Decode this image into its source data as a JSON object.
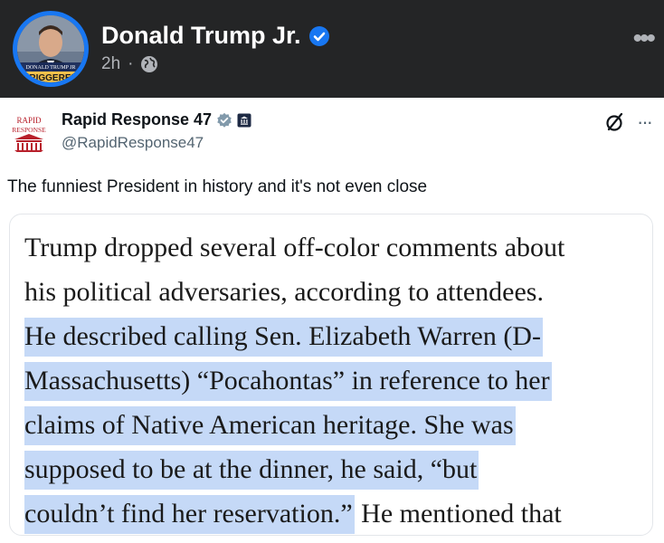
{
  "facebook_post": {
    "author": "Donald Trump Jr.",
    "time": "2h",
    "separator": "·",
    "more_icon": "ellipsis-icon",
    "avatar_text": "DONALD TRUMP JR",
    "avatar_banner": "TRIGGERED",
    "colors": {
      "header_bg": "#242526",
      "verified": "#1877f2",
      "text": "#ffffff",
      "meta": "#b0b3b8"
    }
  },
  "x_post": {
    "author": "Rapid Response 47",
    "handle": "@RapidResponse47",
    "logo_text_top": "RAPID",
    "logo_text_bottom": "RESPONSE",
    "caption": "The funniest President in history and it's not even close",
    "article": {
      "plain_lines": [
        "Trump dropped several off-color comments about",
        "his political adversaries, according to attendees."
      ],
      "highlighted_lines": [
        "He described calling Sen. Elizabeth Warren (D-",
        "Massachusetts) “Pocahontas” in reference to her",
        "claims of Native American heritage. She was",
        "supposed to be at the dinner, he said, “but",
        "couldn’t find her reservation.”"
      ],
      "tail": " He mentioned that"
    },
    "colors": {
      "highlight": "#c5d9f7",
      "handle": "#536471",
      "logo_red": "#b8202b"
    }
  }
}
